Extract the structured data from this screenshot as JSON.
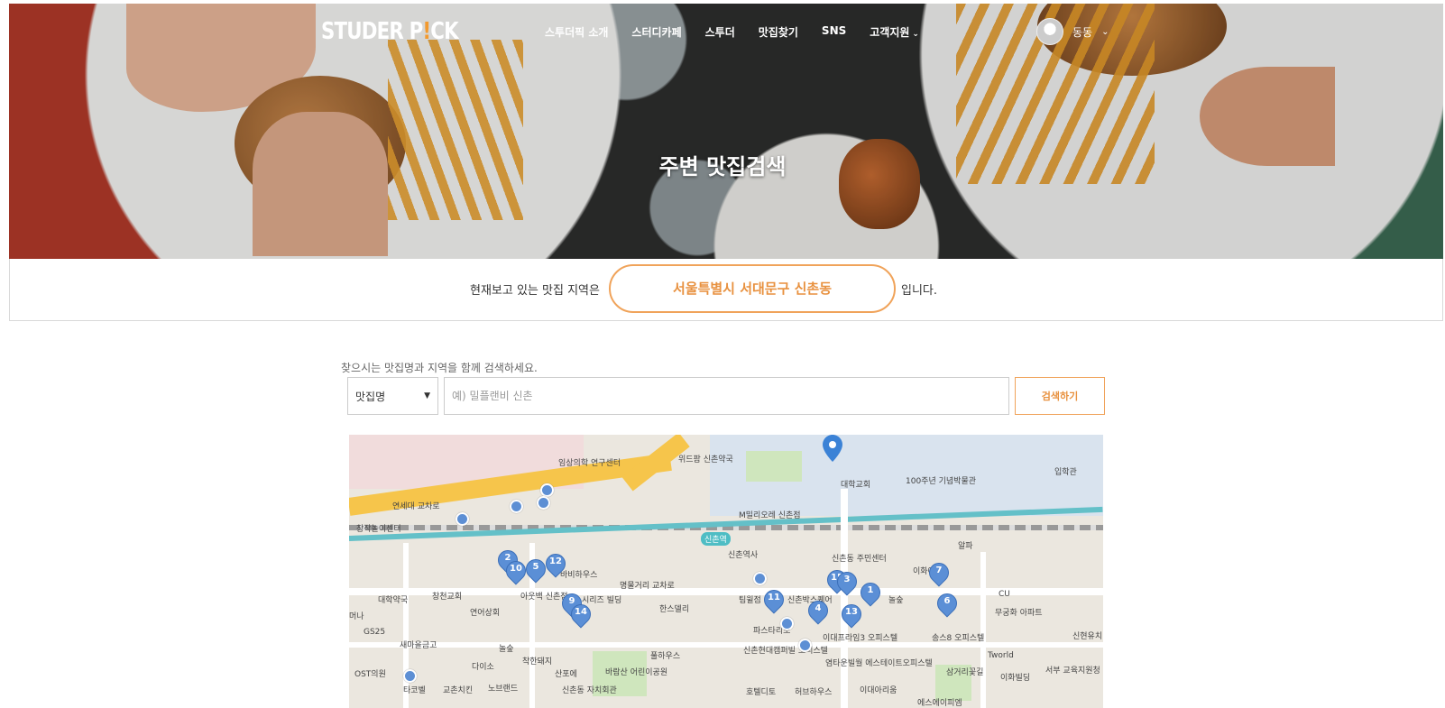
{
  "brand": {
    "logo_main": "STUDER P",
    "logo_bang": "!",
    "logo_end": "CK",
    "accent": "#f39a2e"
  },
  "nav": {
    "items": [
      "스투더픽 소개",
      "스터디카페",
      "스투더",
      "맛집찾기",
      "SNS",
      "고객지원"
    ],
    "support_chevron": "⌄",
    "user_name": "동동",
    "user_chevron": "⌄"
  },
  "hero": {
    "title": "주변 맛집검색"
  },
  "region": {
    "prefix": "현재보고 있는 맛집 지역은",
    "value": "서울특별시 서대문구 신촌동",
    "suffix": "입니다."
  },
  "search": {
    "hint": "찾으시는 맛집명과 지역을 함께 검색하세요.",
    "select_value": "맛집명",
    "placeholder": "예) 밀플랜비 신촌",
    "button": "검색하기"
  },
  "map": {
    "labels": [
      "임상의학 연구센터",
      "위드팜 신촌약국",
      "대학교회",
      "100주년 기념박물관",
      "입학관",
      "연세대 교차로",
      "창작놀이센터",
      "M밀리오레 신촌점",
      "신촌역",
      "신촌역사",
      "신촌동 주민센터",
      "알파",
      "이화여대",
      "바비하우스",
      "명물거리 교차로",
      "창천교회",
      "아웃백 신촌점",
      "시리즈 빌딩",
      "연어상회",
      "한스델리",
      "팀윌점",
      "신촌박스퀘어",
      "놀숲",
      "대학약국",
      "머나",
      "GS25",
      "새마을금고",
      "놀숲",
      "다이소",
      "착한돼지",
      "산포에",
      "바람산 어린이공원",
      "풀하우스",
      "파스타리포",
      "신촌현대캠퍼빌 오피스텔",
      "이대프라임3 오피스텔",
      "송스8 오피스텔",
      "염타운빌월 에스테이트오피스텔",
      "OST의원",
      "타코벨",
      "교촌치킨",
      "노브랜드",
      "신촌동 자치회관",
      "호텔디토",
      "허브하우스",
      "이대아리움",
      "삼거리꽃길",
      "Tworld",
      "이화빌딩",
      "CU",
      "무궁화 아파트",
      "신현유치",
      "서부 교육지원청",
      "에스에이피엠"
    ],
    "station_name": "신촌역",
    "markers": [
      "1",
      "2",
      "3",
      "4",
      "5",
      "6",
      "7",
      "9",
      "10",
      "11",
      "12",
      "13",
      "14",
      "15"
    ]
  }
}
